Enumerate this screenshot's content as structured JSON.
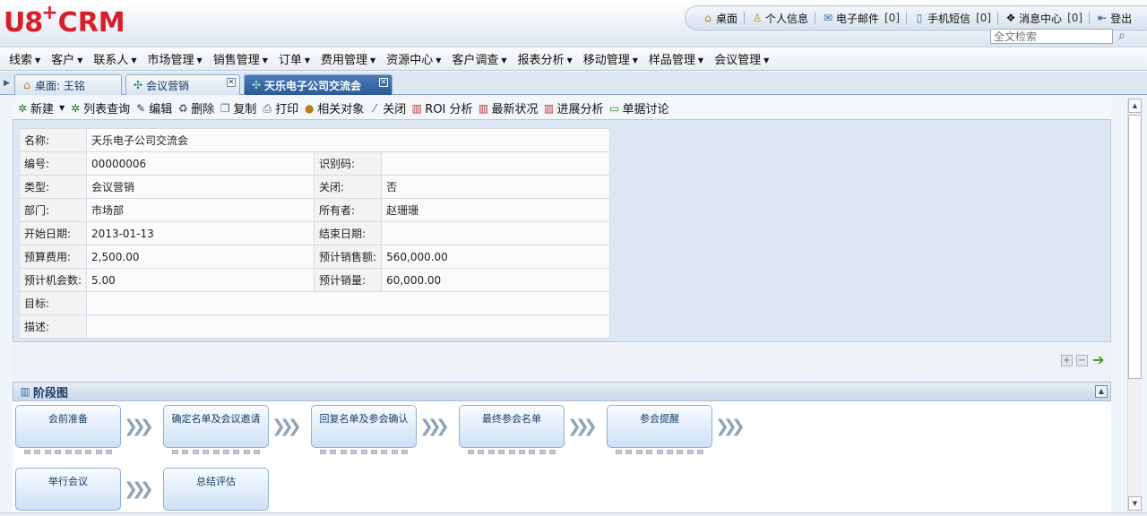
{
  "logo": {
    "u8": "U8",
    "plus": "+",
    "crm": "CRM"
  },
  "topnav": {
    "desk": "桌面",
    "profile": "个人信息",
    "email": "电子邮件",
    "email_count": "[0]",
    "sms": "手机短信",
    "sms_count": "[0]",
    "messages": "消息中心",
    "messages_count": "[0]",
    "logout": "登出"
  },
  "search": {
    "placeholder": "全文检索"
  },
  "menu": [
    "线索",
    "客户",
    "联系人",
    "市场管理",
    "销售管理",
    "订单",
    "费用管理",
    "资源中心",
    "客户调查",
    "报表分析",
    "移动管理",
    "样品管理",
    "会议管理"
  ],
  "tabs": [
    {
      "label": "桌面: 王铭"
    },
    {
      "label": "会议营销"
    },
    {
      "label": "天乐电子公司交流会"
    }
  ],
  "toolbar": [
    "新建",
    "列表查询",
    "编辑",
    "删除",
    "复制",
    "打印",
    "相关对象",
    "关闭",
    "ROI 分析",
    "最新状况",
    "进展分析",
    "单据讨论"
  ],
  "record": {
    "name_label": "名称:",
    "name": "天乐电子公司交流会",
    "code_label": "编号:",
    "code": "00000006",
    "idcode_label": "识别码:",
    "idcode": "",
    "type_label": "类型:",
    "type": "会议营销",
    "closed_label": "关闭:",
    "closed": "否",
    "dept_label": "部门:",
    "dept": "市场部",
    "owner_label": "所有者:",
    "owner": "赵珊珊",
    "start_label": "开始日期:",
    "start": "2013-01-13",
    "end_label": "结束日期:",
    "end": "",
    "budget_label": "预算费用:",
    "budget": "2,500.00",
    "sales_label": "预计销售额:",
    "sales": "560,000.00",
    "opps_label": "预计机会数:",
    "opps": "5.00",
    "qty_label": "预计销量:",
    "qty": "60,000.00",
    "goal_label": "目标:",
    "goal": "",
    "desc_label": "描述:",
    "desc": ""
  },
  "stage_section": {
    "title": "阶段图",
    "stages": [
      "会前准备",
      "确定名单及会议邀请",
      "回复名单及参会确认",
      "最终参会名单",
      "参会提醒",
      "举行会议",
      "总结评估"
    ]
  },
  "colors": {
    "brand": "#d81e28",
    "active_tab": "#2c5a96",
    "panel": "#dde7f3"
  }
}
